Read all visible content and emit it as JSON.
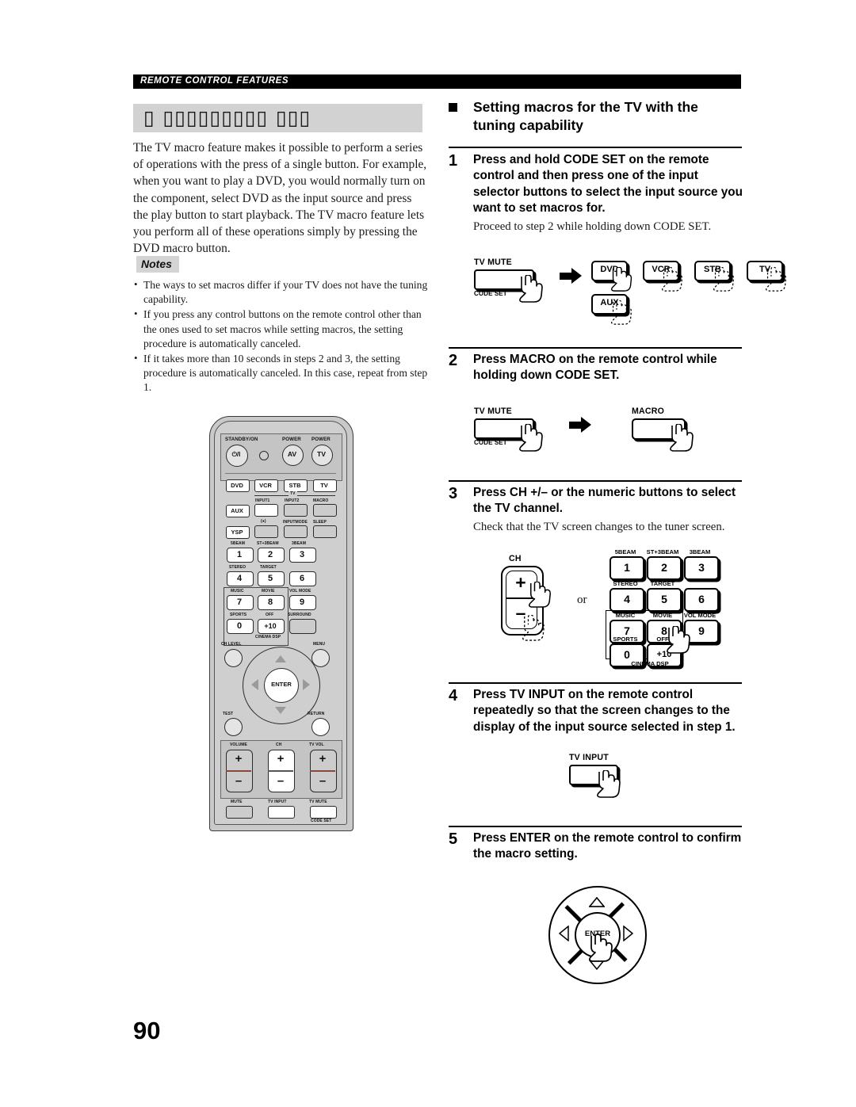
{
  "header": {
    "running_head": "REMOTE CONTROL FEATURES"
  },
  "page_number": "90",
  "left_column": {
    "section_title_glyphs": "▯ ▯▯▯▯▯▯▯▯▯ ▯▯▯",
    "intro_paragraph": "The TV macro feature makes it possible to perform a series of operations with the press of a single button. For example, when you want to play a DVD, you would normally turn on the component, select DVD as the input source and press the play button to start playback. The TV macro feature lets you perform all of these operations simply by pressing the DVD macro button.",
    "notes_label": "Notes",
    "notes": [
      "The ways to set macros differ if your TV does not have the tuning capability.",
      "If you press any control buttons on the remote control other than the ones used to set macros while setting macros, the setting procedure is automatically canceled.",
      "If it takes more than 10 seconds in steps 2 and 3, the setting procedure is automatically canceled. In this case, repeat from step 1."
    ]
  },
  "remote_diagram": {
    "name": "remote-control-overview",
    "standby_label": "STANDBY/ON",
    "standby_glyph": "⏻/I",
    "power_av_label": "POWER",
    "power_av": "AV",
    "power_tv_label": "POWER",
    "power_tv": "TV",
    "source_row": [
      "DVD",
      "VCR",
      "STB",
      "TV"
    ],
    "tv_bracket_label": "TV",
    "row2_labels": [
      "INPUT1",
      "INPUT2",
      "MACRO"
    ],
    "aux": "AUX",
    "row3_labels": [
      "(●)",
      "INPUTMODE",
      "SLEEP"
    ],
    "ysp": "YSP",
    "keypad_top_labels": [
      "5BEAM",
      "ST+3BEAM",
      "3BEAM"
    ],
    "keypad_row1": [
      "1",
      "2",
      "3"
    ],
    "keypad_mid_labels": [
      "STEREO",
      "TARGET",
      ""
    ],
    "keypad_row2": [
      "4",
      "5",
      "6"
    ],
    "keypad_labels3": [
      "MUSIC",
      "MOVIE",
      "VOL MODE"
    ],
    "keypad_row3": [
      "7",
      "8",
      "9"
    ],
    "keypad_labels4": [
      "SPORTS",
      "OFF",
      "SURROUND"
    ],
    "keypad_row4": [
      "0",
      "+10",
      ""
    ],
    "cinema_dsp": "CINEMA DSP",
    "ch_level": "CH LEVEL",
    "menu": "MENU",
    "test": "TEST",
    "return": "RETURN",
    "enter": "ENTER",
    "volume": "VOLUME",
    "ch": "CH",
    "tv_vol": "TV VOL",
    "plus": "+",
    "minus": "–",
    "mute": "MUTE",
    "tv_input": "TV INPUT",
    "tv_mute": "TV MUTE",
    "code_set": "CODE SET"
  },
  "right_column": {
    "section_heading": "Setting macros for the TV with the tuning capability",
    "steps": [
      {
        "number": "1",
        "instruction": "Press and hold CODE SET on the remote control and then press one of the input selector buttons to select the input source you want to set macros for.",
        "sub": "Proceed to step 2 while holding down CODE SET.",
        "figure": {
          "name": "step1-figure",
          "tv_mute_label": "TV MUTE",
          "code_set_label": "CODE SET",
          "targets_row1": [
            "DVD",
            "VCR",
            "STB",
            "TV"
          ],
          "targets_row2": [
            "AUX"
          ]
        }
      },
      {
        "number": "2",
        "instruction": "Press MACRO on the remote control while holding down CODE SET.",
        "sub": "",
        "figure": {
          "name": "step2-figure",
          "tv_mute_label": "TV MUTE",
          "code_set_label": "CODE SET",
          "macro_label": "MACRO"
        }
      },
      {
        "number": "3",
        "instruction": "Press CH +/– or the numeric buttons to select the TV channel.",
        "sub": "Check that the TV screen changes to the tuner screen.",
        "figure": {
          "name": "step3-figure",
          "ch_label": "CH",
          "plus": "+",
          "minus": "–",
          "or_label": "or",
          "keypad_top_labels": [
            "5BEAM",
            "ST+3BEAM",
            "3BEAM"
          ],
          "keypad_row1": [
            "1",
            "2",
            "3"
          ],
          "keypad_mid_labels": [
            "STEREO",
            "TARGET",
            ""
          ],
          "keypad_row2": [
            "4",
            "5",
            "6"
          ],
          "keypad_labels3": [
            "MUSIC",
            "MOVIE",
            "VOL MODE"
          ],
          "keypad_row3": [
            "7",
            "8",
            "9"
          ],
          "keypad_labels4": [
            "SPORTS",
            "OFF",
            ""
          ],
          "keypad_row4": [
            "0",
            "+10",
            ""
          ],
          "cinema_dsp": "CINEMA DSP"
        }
      },
      {
        "number": "4",
        "instruction": "Press TV INPUT on the remote control repeatedly so that the screen changes to the display of the input source selected in step 1.",
        "sub": "",
        "figure": {
          "name": "step4-figure",
          "tv_input_label": "TV INPUT"
        }
      },
      {
        "number": "5",
        "instruction": "Press ENTER on the remote control to confirm the macro setting.",
        "sub": "",
        "figure": {
          "name": "step5-figure",
          "enter_label": "ENTER"
        }
      }
    ]
  },
  "colors": {
    "header_bar": "#000000",
    "title_band": "#d2d2d2",
    "notes_tag": "#d4d4d4",
    "remote_body": "#c9c9c9",
    "ink": "#000000"
  }
}
